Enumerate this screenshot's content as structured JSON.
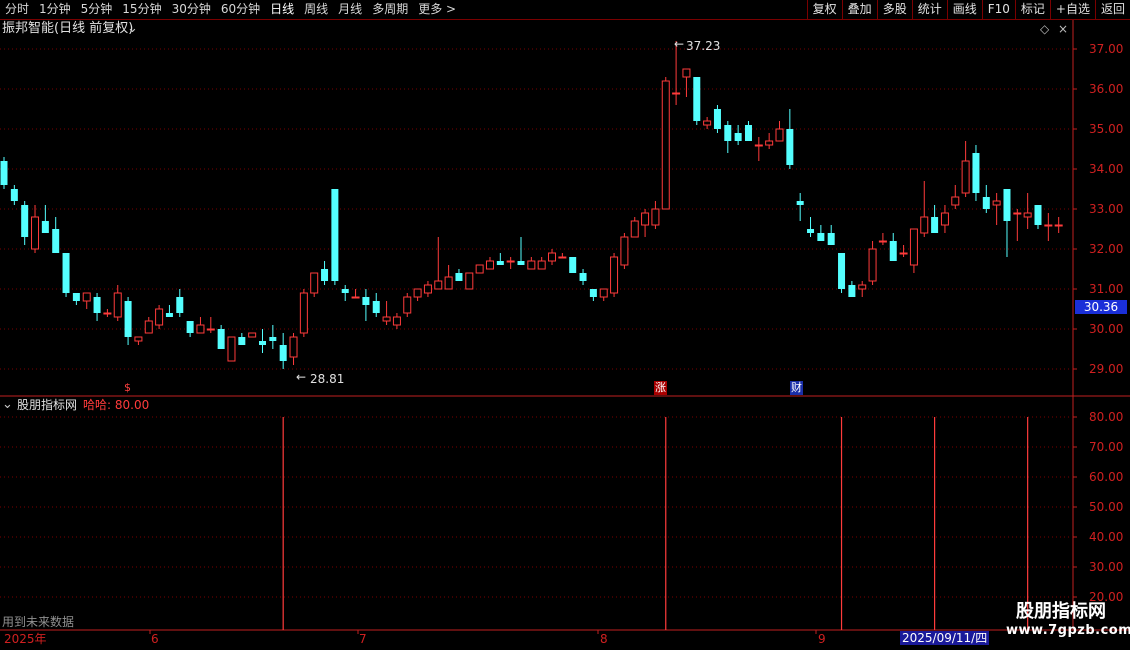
{
  "toolbar": {
    "left": [
      "分时",
      "1分钟",
      "5分钟",
      "15分钟",
      "30分钟",
      "60分钟",
      "日线",
      "周线",
      "月线",
      "多周期",
      "更多 >"
    ],
    "active_index": 6,
    "right": [
      "复权",
      "叠加",
      "多股",
      "统计",
      "画线",
      "F10",
      "标记",
      "+自选",
      "返回"
    ]
  },
  "main_panel": {
    "title": "振邦智能(日线 前复权)",
    "high_label": "37.23",
    "low_label": "28.81",
    "price_badge": "30.36",
    "markers": [
      "$",
      "涨",
      "财"
    ]
  },
  "indicator_panel": {
    "name": "股朋指标网",
    "value_label": "哈哈: 80.00",
    "footer_note": "用到未来数据"
  },
  "time_axis": {
    "labels": [
      "2025年",
      "6",
      "7",
      "8",
      "9"
    ],
    "cursor_date": "2025/09/11/四"
  },
  "watermark": {
    "line1": "股朋指标网",
    "line2": "www.7gpzb.com"
  },
  "colors": {
    "up": "#ff3b3b",
    "down": "#54ffff",
    "axis": "#c02020",
    "badge": "#1a2fd8"
  },
  "chart_data": {
    "type": "candlestick",
    "y_ticks": [
      37,
      36,
      35,
      34,
      33,
      32,
      31,
      30,
      29
    ],
    "indicator_ticks": [
      80,
      70,
      60,
      50,
      40,
      30,
      20
    ],
    "ohlc": [
      [
        34.2,
        34.3,
        33.5,
        33.6
      ],
      [
        33.5,
        33.6,
        33.1,
        33.2
      ],
      [
        33.1,
        33.2,
        32.1,
        32.3
      ],
      [
        32.0,
        33.1,
        31.9,
        32.8
      ],
      [
        32.7,
        33.1,
        32.4,
        32.4
      ],
      [
        32.5,
        32.8,
        31.9,
        31.9
      ],
      [
        31.9,
        31.9,
        30.8,
        30.9
      ],
      [
        30.9,
        30.9,
        30.6,
        30.7
      ],
      [
        30.7,
        30.9,
        30.5,
        30.9
      ],
      [
        30.8,
        30.9,
        30.2,
        30.4
      ],
      [
        30.4,
        30.5,
        30.3,
        30.4
      ],
      [
        30.3,
        31.1,
        30.2,
        30.9
      ],
      [
        30.7,
        30.8,
        29.6,
        29.8
      ],
      [
        29.7,
        29.8,
        29.6,
        29.8
      ],
      [
        29.9,
        30.3,
        29.9,
        30.2
      ],
      [
        30.1,
        30.6,
        30.0,
        30.5
      ],
      [
        30.4,
        30.6,
        30.3,
        30.3
      ],
      [
        30.8,
        31.0,
        30.3,
        30.4
      ],
      [
        30.2,
        30.2,
        29.8,
        29.9
      ],
      [
        29.9,
        30.3,
        29.9,
        30.1
      ],
      [
        30.0,
        30.3,
        29.9,
        30.0
      ],
      [
        30.0,
        30.1,
        29.5,
        29.5
      ],
      [
        29.2,
        29.8,
        29.2,
        29.8
      ],
      [
        29.8,
        29.9,
        29.6,
        29.6
      ],
      [
        29.8,
        29.9,
        29.8,
        29.9
      ],
      [
        29.7,
        30.0,
        29.4,
        29.6
      ],
      [
        29.8,
        30.1,
        29.5,
        29.7
      ],
      [
        29.6,
        29.9,
        29.0,
        29.2
      ],
      [
        29.3,
        29.9,
        29.1,
        29.8
      ],
      [
        29.9,
        31.0,
        29.8,
        30.9
      ],
      [
        30.9,
        31.3,
        30.8,
        31.4
      ],
      [
        31.5,
        31.7,
        31.1,
        31.2
      ],
      [
        33.5,
        33.5,
        31.1,
        31.2
      ],
      [
        31.0,
        31.1,
        30.7,
        30.9
      ],
      [
        30.8,
        31.0,
        30.8,
        30.8
      ],
      [
        30.8,
        31.0,
        30.2,
        30.6
      ],
      [
        30.7,
        30.9,
        30.3,
        30.4
      ],
      [
        30.2,
        30.7,
        30.1,
        30.3
      ],
      [
        30.1,
        30.4,
        30.0,
        30.3
      ],
      [
        30.4,
        30.9,
        30.3,
        30.8
      ],
      [
        30.8,
        31.0,
        30.7,
        31.0
      ],
      [
        30.9,
        31.2,
        30.8,
        31.1
      ],
      [
        31.0,
        32.3,
        31.0,
        31.2
      ],
      [
        31.0,
        31.6,
        31.0,
        31.3
      ],
      [
        31.4,
        31.5,
        31.2,
        31.2
      ],
      [
        31.0,
        31.4,
        31.0,
        31.4
      ],
      [
        31.4,
        31.6,
        31.4,
        31.6
      ],
      [
        31.5,
        31.8,
        31.5,
        31.7
      ],
      [
        31.7,
        31.9,
        31.6,
        31.6
      ],
      [
        31.7,
        31.8,
        31.5,
        31.7
      ],
      [
        31.7,
        32.3,
        31.6,
        31.6
      ],
      [
        31.5,
        31.8,
        31.5,
        31.7
      ],
      [
        31.5,
        31.8,
        31.5,
        31.7
      ],
      [
        31.7,
        32.0,
        31.6,
        31.9
      ],
      [
        31.8,
        31.9,
        31.8,
        31.8
      ],
      [
        31.8,
        31.8,
        31.4,
        31.4
      ],
      [
        31.4,
        31.5,
        31.1,
        31.2
      ],
      [
        31.0,
        31.0,
        30.7,
        30.8
      ],
      [
        30.8,
        31.0,
        30.7,
        31.0
      ],
      [
        30.9,
        31.9,
        30.8,
        31.8
      ],
      [
        31.6,
        32.4,
        31.5,
        32.3
      ],
      [
        32.3,
        32.8,
        32.3,
        32.7
      ],
      [
        32.6,
        33.0,
        32.3,
        32.9
      ],
      [
        32.6,
        33.2,
        32.5,
        33.0
      ],
      [
        33.0,
        36.3,
        33.0,
        36.2
      ],
      [
        35.9,
        37.2,
        35.6,
        35.9
      ],
      [
        36.3,
        36.5,
        35.8,
        36.5
      ],
      [
        36.3,
        36.3,
        35.1,
        35.2
      ],
      [
        35.1,
        35.3,
        35.0,
        35.2
      ],
      [
        35.5,
        35.6,
        34.9,
        35.0
      ],
      [
        35.1,
        35.2,
        34.4,
        34.7
      ],
      [
        34.9,
        35.1,
        34.6,
        34.7
      ],
      [
        35.1,
        35.2,
        34.7,
        34.7
      ],
      [
        34.6,
        34.8,
        34.2,
        34.6
      ],
      [
        34.6,
        34.9,
        34.5,
        34.7
      ],
      [
        34.7,
        35.2,
        34.7,
        35.0
      ],
      [
        35.0,
        35.5,
        34.0,
        34.1
      ],
      [
        33.2,
        33.4,
        32.7,
        33.1
      ],
      [
        32.5,
        32.8,
        32.3,
        32.4
      ],
      [
        32.4,
        32.6,
        32.3,
        32.2
      ],
      [
        32.4,
        32.6,
        32.1,
        32.1
      ],
      [
        31.9,
        31.9,
        30.9,
        31.0
      ],
      [
        31.1,
        31.2,
        30.8,
        30.8
      ],
      [
        31.0,
        31.2,
        30.8,
        31.1
      ],
      [
        31.2,
        32.2,
        31.1,
        32.0
      ],
      [
        32.2,
        32.4,
        32.1,
        32.2
      ],
      [
        32.2,
        32.4,
        31.9,
        31.7
      ],
      [
        31.9,
        32.1,
        31.8,
        31.9
      ],
      [
        31.6,
        32.3,
        31.4,
        32.5
      ],
      [
        32.4,
        33.7,
        32.3,
        32.8
      ],
      [
        32.8,
        33.1,
        32.5,
        32.4
      ],
      [
        32.6,
        33.1,
        32.4,
        32.9
      ],
      [
        33.1,
        33.6,
        33.0,
        33.3
      ],
      [
        33.4,
        34.7,
        33.3,
        34.2
      ],
      [
        34.4,
        34.6,
        33.2,
        33.4
      ],
      [
        33.3,
        33.6,
        32.9,
        33.0
      ],
      [
        33.1,
        33.4,
        32.6,
        33.2
      ],
      [
        33.5,
        33.5,
        31.8,
        32.7
      ],
      [
        32.9,
        33.0,
        32.2,
        32.9
      ],
      [
        32.8,
        33.4,
        32.5,
        32.9
      ],
      [
        33.1,
        33.1,
        32.5,
        32.6
      ],
      [
        32.6,
        32.9,
        32.2,
        32.6
      ],
      [
        32.6,
        32.8,
        32.4,
        32.6
      ]
    ],
    "signals": [
      {
        "index": 27,
        "value": 80
      },
      {
        "index": 64,
        "value": 80
      },
      {
        "index": 81,
        "value": 80
      },
      {
        "index": 90,
        "value": 80
      },
      {
        "index": 99,
        "value": 80
      }
    ]
  }
}
